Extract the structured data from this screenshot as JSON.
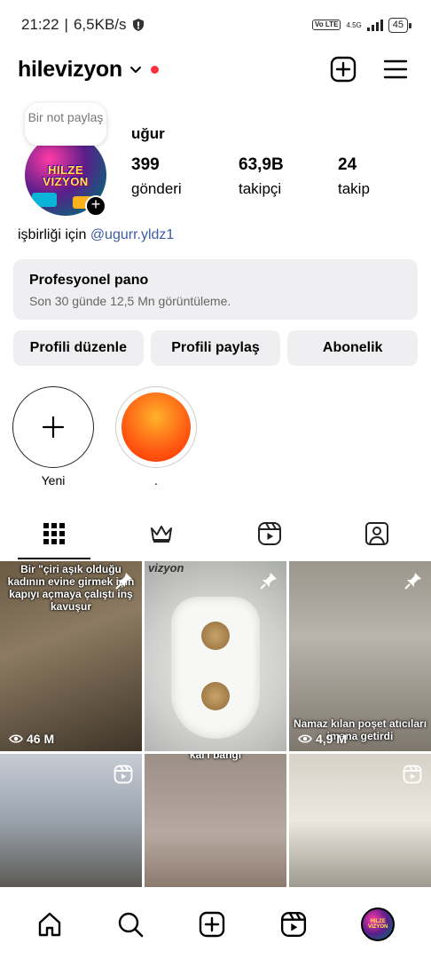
{
  "status_bar": {
    "time": "21:22",
    "speed": "6,5KB/s",
    "volte": "Vo LTE",
    "network": "4.5G",
    "battery": "45"
  },
  "header": {
    "username": "hilevizyon"
  },
  "profile": {
    "note": "Bir not paylaş",
    "avatar_text": "HILZE VIZYON",
    "name": "uğur",
    "posts_count": "399",
    "posts_label": "gönderi",
    "followers_count": "63,9B",
    "followers_label": "takipçi",
    "following_count": "24",
    "following_label": "takip",
    "bio_prefix": "işbirliği için",
    "bio_link": "@ugurr.yldz1"
  },
  "pro_dashboard": {
    "title": "Profesyonel pano",
    "subtitle": "Son 30 günde 12,5 Mn görüntüleme."
  },
  "buttons": {
    "edit": "Profili düzenle",
    "share": "Profili paylaş",
    "subscribe": "Abonelik"
  },
  "highlights": [
    {
      "label": "Yeni"
    },
    {
      "label": "."
    }
  ],
  "grid": {
    "posts": [
      {
        "caption": "Bir \"çiri aşık olduğu kadının evine girmek için kapıyı açmaya çalıştı inş kavuşur",
        "views": "46 M"
      },
      {
        "caption": "",
        "watermark": "vizyon"
      },
      {
        "caption": "Namaz kılan poşet atıcıları imana getirdi",
        "views": "4,9 M"
      },
      {
        "caption": ""
      },
      {
        "caption": "kal'ı bangı"
      },
      {
        "caption": ""
      }
    ]
  },
  "colors": {
    "accent_link": "#3d5ba9",
    "notification": "#ff3040",
    "button_bg": "#efeff1"
  }
}
